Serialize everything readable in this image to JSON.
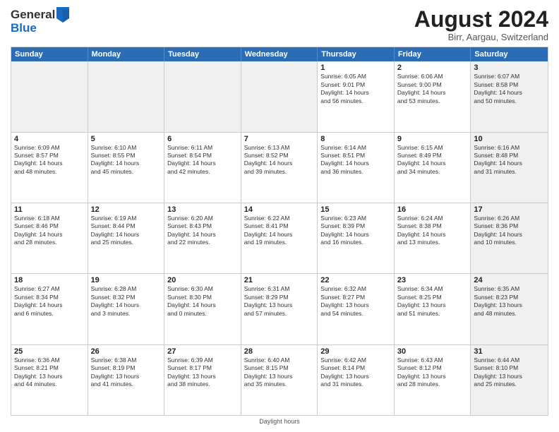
{
  "logo": {
    "general": "General",
    "blue": "Blue"
  },
  "title": "August 2024",
  "location": "Birr, Aargau, Switzerland",
  "days_of_week": [
    "Sunday",
    "Monday",
    "Tuesday",
    "Wednesday",
    "Thursday",
    "Friday",
    "Saturday"
  ],
  "footer": "Daylight hours",
  "weeks": [
    [
      {
        "day": "",
        "text": "",
        "shaded": true
      },
      {
        "day": "",
        "text": "",
        "shaded": true
      },
      {
        "day": "",
        "text": "",
        "shaded": true
      },
      {
        "day": "",
        "text": "",
        "shaded": true
      },
      {
        "day": "1",
        "text": "Sunrise: 6:05 AM\nSunset: 9:01 PM\nDaylight: 14 hours\nand 56 minutes.",
        "shaded": false
      },
      {
        "day": "2",
        "text": "Sunrise: 6:06 AM\nSunset: 9:00 PM\nDaylight: 14 hours\nand 53 minutes.",
        "shaded": false
      },
      {
        "day": "3",
        "text": "Sunrise: 6:07 AM\nSunset: 8:58 PM\nDaylight: 14 hours\nand 50 minutes.",
        "shaded": true
      }
    ],
    [
      {
        "day": "4",
        "text": "Sunrise: 6:09 AM\nSunset: 8:57 PM\nDaylight: 14 hours\nand 48 minutes.",
        "shaded": false
      },
      {
        "day": "5",
        "text": "Sunrise: 6:10 AM\nSunset: 8:55 PM\nDaylight: 14 hours\nand 45 minutes.",
        "shaded": false
      },
      {
        "day": "6",
        "text": "Sunrise: 6:11 AM\nSunset: 8:54 PM\nDaylight: 14 hours\nand 42 minutes.",
        "shaded": false
      },
      {
        "day": "7",
        "text": "Sunrise: 6:13 AM\nSunset: 8:52 PM\nDaylight: 14 hours\nand 39 minutes.",
        "shaded": false
      },
      {
        "day": "8",
        "text": "Sunrise: 6:14 AM\nSunset: 8:51 PM\nDaylight: 14 hours\nand 36 minutes.",
        "shaded": false
      },
      {
        "day": "9",
        "text": "Sunrise: 6:15 AM\nSunset: 8:49 PM\nDaylight: 14 hours\nand 34 minutes.",
        "shaded": false
      },
      {
        "day": "10",
        "text": "Sunrise: 6:16 AM\nSunset: 8:48 PM\nDaylight: 14 hours\nand 31 minutes.",
        "shaded": true
      }
    ],
    [
      {
        "day": "11",
        "text": "Sunrise: 6:18 AM\nSunset: 8:46 PM\nDaylight: 14 hours\nand 28 minutes.",
        "shaded": false
      },
      {
        "day": "12",
        "text": "Sunrise: 6:19 AM\nSunset: 8:44 PM\nDaylight: 14 hours\nand 25 minutes.",
        "shaded": false
      },
      {
        "day": "13",
        "text": "Sunrise: 6:20 AM\nSunset: 8:43 PM\nDaylight: 14 hours\nand 22 minutes.",
        "shaded": false
      },
      {
        "day": "14",
        "text": "Sunrise: 6:22 AM\nSunset: 8:41 PM\nDaylight: 14 hours\nand 19 minutes.",
        "shaded": false
      },
      {
        "day": "15",
        "text": "Sunrise: 6:23 AM\nSunset: 8:39 PM\nDaylight: 14 hours\nand 16 minutes.",
        "shaded": false
      },
      {
        "day": "16",
        "text": "Sunrise: 6:24 AM\nSunset: 8:38 PM\nDaylight: 14 hours\nand 13 minutes.",
        "shaded": false
      },
      {
        "day": "17",
        "text": "Sunrise: 6:26 AM\nSunset: 8:36 PM\nDaylight: 14 hours\nand 10 minutes.",
        "shaded": true
      }
    ],
    [
      {
        "day": "18",
        "text": "Sunrise: 6:27 AM\nSunset: 8:34 PM\nDaylight: 14 hours\nand 6 minutes.",
        "shaded": false
      },
      {
        "day": "19",
        "text": "Sunrise: 6:28 AM\nSunset: 8:32 PM\nDaylight: 14 hours\nand 3 minutes.",
        "shaded": false
      },
      {
        "day": "20",
        "text": "Sunrise: 6:30 AM\nSunset: 8:30 PM\nDaylight: 14 hours\nand 0 minutes.",
        "shaded": false
      },
      {
        "day": "21",
        "text": "Sunrise: 6:31 AM\nSunset: 8:29 PM\nDaylight: 13 hours\nand 57 minutes.",
        "shaded": false
      },
      {
        "day": "22",
        "text": "Sunrise: 6:32 AM\nSunset: 8:27 PM\nDaylight: 13 hours\nand 54 minutes.",
        "shaded": false
      },
      {
        "day": "23",
        "text": "Sunrise: 6:34 AM\nSunset: 8:25 PM\nDaylight: 13 hours\nand 51 minutes.",
        "shaded": false
      },
      {
        "day": "24",
        "text": "Sunrise: 6:35 AM\nSunset: 8:23 PM\nDaylight: 13 hours\nand 48 minutes.",
        "shaded": true
      }
    ],
    [
      {
        "day": "25",
        "text": "Sunrise: 6:36 AM\nSunset: 8:21 PM\nDaylight: 13 hours\nand 44 minutes.",
        "shaded": false
      },
      {
        "day": "26",
        "text": "Sunrise: 6:38 AM\nSunset: 8:19 PM\nDaylight: 13 hours\nand 41 minutes.",
        "shaded": false
      },
      {
        "day": "27",
        "text": "Sunrise: 6:39 AM\nSunset: 8:17 PM\nDaylight: 13 hours\nand 38 minutes.",
        "shaded": false
      },
      {
        "day": "28",
        "text": "Sunrise: 6:40 AM\nSunset: 8:15 PM\nDaylight: 13 hours\nand 35 minutes.",
        "shaded": false
      },
      {
        "day": "29",
        "text": "Sunrise: 6:42 AM\nSunset: 8:14 PM\nDaylight: 13 hours\nand 31 minutes.",
        "shaded": false
      },
      {
        "day": "30",
        "text": "Sunrise: 6:43 AM\nSunset: 8:12 PM\nDaylight: 13 hours\nand 28 minutes.",
        "shaded": false
      },
      {
        "day": "31",
        "text": "Sunrise: 6:44 AM\nSunset: 8:10 PM\nDaylight: 13 hours\nand 25 minutes.",
        "shaded": true
      }
    ]
  ]
}
